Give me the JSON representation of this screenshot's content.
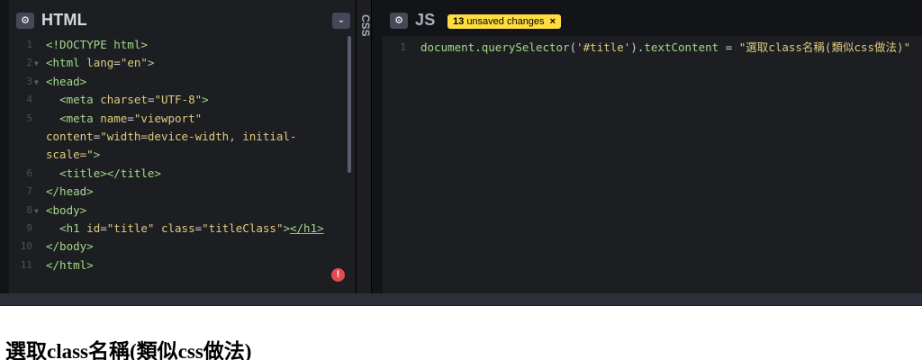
{
  "html_panel": {
    "title": "HTML",
    "settings_icon": "gear-icon",
    "collapse_icon": "chevron-down-icon",
    "lines": [
      {
        "n": "1"
      },
      {
        "n": "2"
      },
      {
        "n": "3"
      },
      {
        "n": "4"
      },
      {
        "n": "5"
      },
      {
        "n": "6"
      },
      {
        "n": "7"
      },
      {
        "n": "8"
      },
      {
        "n": "9"
      },
      {
        "n": "10"
      },
      {
        "n": "11"
      }
    ],
    "code": {
      "l1": "<!DOCTYPE html>",
      "l2_open": "<html",
      "l2_attr": "lang",
      "l2_val": "\"en\"",
      "l2_close": ">",
      "l3": "<head>",
      "l4_open": "<meta",
      "l4_attr": "charset",
      "l4_val": "\"UTF-8\"",
      "l4_close": ">",
      "l5_open": "<meta",
      "l5_attr": "name",
      "l5_val": "\"viewport\"",
      "l5b_attr": "content",
      "l5b_val": "\"width=device-width, initial-",
      "l5c_val": "scale=\"",
      "l5c_close": ">",
      "l6": "<title></title>",
      "l7": "</head>",
      "l8": "<body>",
      "l9_open": "<h1",
      "l9_attr1": "id",
      "l9_val1": "\"title\"",
      "l9_attr2": "class",
      "l9_val2": "\"titleClass\"",
      "l9_gt": ">",
      "l9_closer": "</h1>",
      "l10": "</body>",
      "l11": "</html>"
    },
    "error_badge": "!"
  },
  "css_panel": {
    "title": "CSS"
  },
  "js_panel": {
    "title": "JS",
    "settings_icon": "gear-icon",
    "unsaved_count": "13",
    "unsaved_label": "unsaved changes",
    "unsaved_close": "×",
    "line_number": "1",
    "code": {
      "obj": "document",
      "dot1": ".",
      "method": "querySelector",
      "paren_open": "(",
      "selector": "'#title'",
      "paren_close": ")",
      "dot2": ".",
      "prop": "textContent",
      "assign": " = ",
      "value": "\"選取class名稱(類似css做法)\""
    }
  },
  "preview": {
    "h1_text": "選取class名稱(類似css做法)"
  },
  "colors": {
    "editor_bg": "#1d1e22",
    "app_bg": "#131417",
    "badge_bg": "#ffdd40",
    "tag_green": "#a2d88a",
    "string_yellow": "#ddca7e",
    "error_red": "#e24b52"
  }
}
